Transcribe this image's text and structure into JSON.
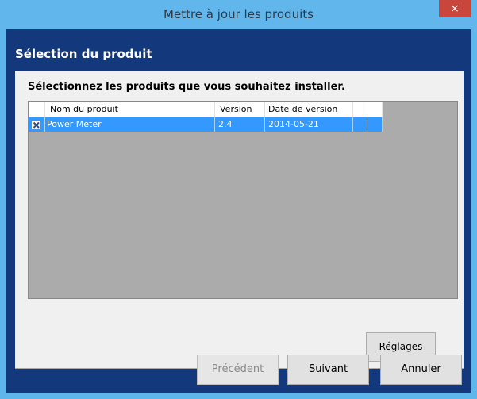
{
  "window": {
    "title": "Mettre à jour les produits",
    "close_glyph": "×"
  },
  "page": {
    "title": "Sélection du produit",
    "instruction": "Sélectionnez les produits que vous souhaitez installer."
  },
  "grid": {
    "headers": {
      "name": "Nom du produit",
      "version": "Version",
      "date": "Date de version"
    },
    "rows": [
      {
        "checked": true,
        "name": "Power Meter",
        "version": "2.4",
        "date": "2014-05-21",
        "selected": true
      }
    ]
  },
  "buttons": {
    "settings": "Réglages",
    "previous": "Précédent",
    "next": "Suivant",
    "cancel": "Annuler"
  },
  "colors": {
    "titlebar": "#61b7ec",
    "client": "#13387c",
    "selection": "#3399ff",
    "close": "#c9463d"
  }
}
